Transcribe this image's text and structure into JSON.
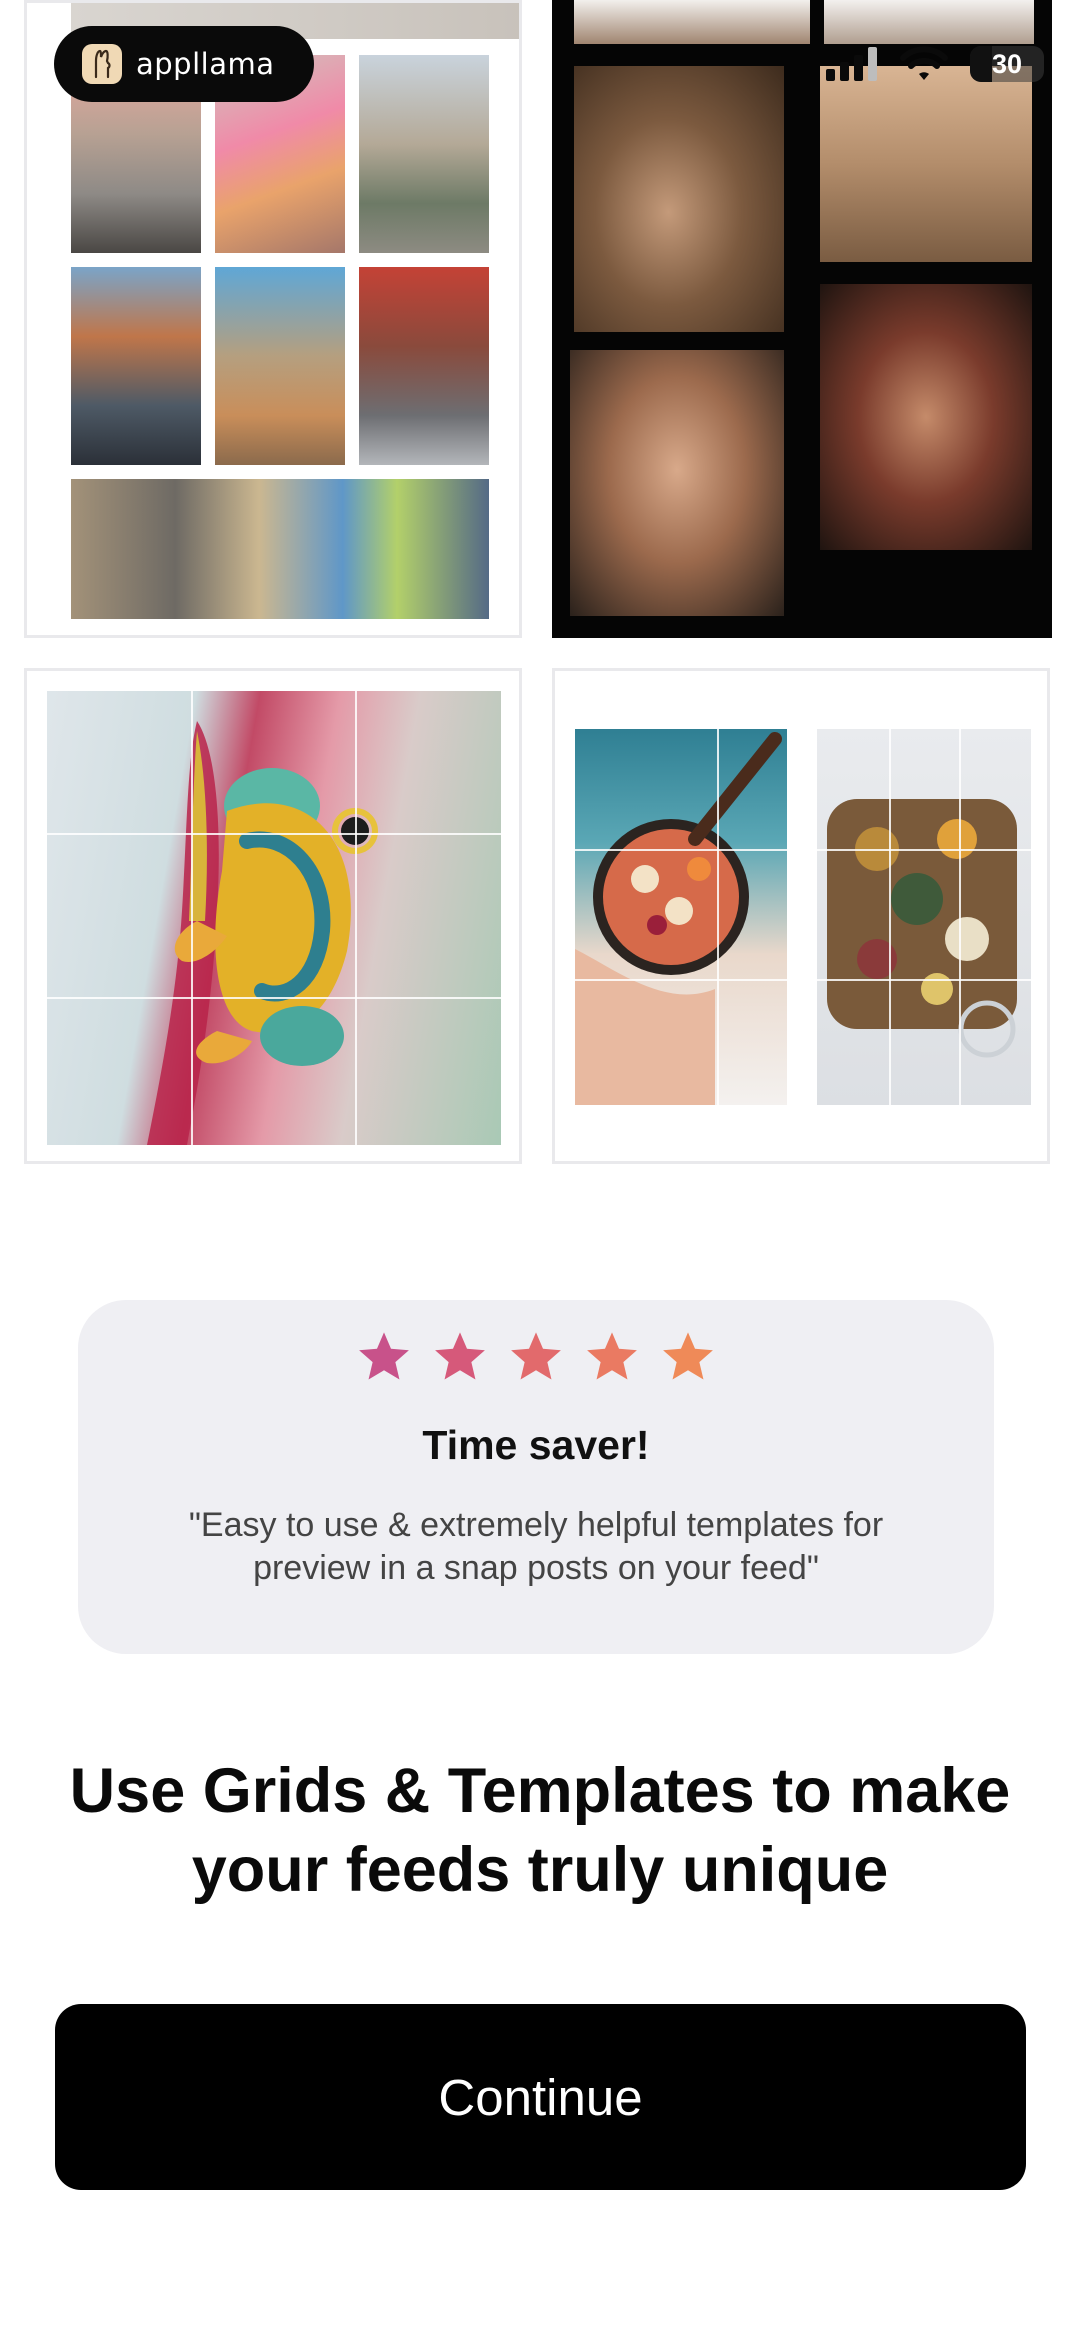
{
  "logo": {
    "text": "appllama",
    "icon": "llama-logo-icon"
  },
  "status_bar": {
    "battery_text": "30",
    "battery_level": 0.3,
    "icons": [
      "cellular-signal-icon",
      "wifi-icon",
      "battery-icon"
    ]
  },
  "templates": [
    {
      "name": "city-collage",
      "icon": "photo-collage"
    },
    {
      "name": "portrait-collage",
      "icon": "photo-collage"
    },
    {
      "name": "frog-grid",
      "icon": "grid-overlay"
    },
    {
      "name": "food-grid",
      "icon": "grid-overlay"
    }
  ],
  "review": {
    "stars": 5,
    "star_colors": [
      "#c8528a",
      "#d6597a",
      "#e26a6c",
      "#ea7a62",
      "#ef8a58"
    ],
    "title": "Time saver!",
    "quote": "\"Easy to use & extremely helpful templates for preview in a snap posts on your feed\""
  },
  "headline": "Use Grids & Templates to make your feeds truly unique",
  "continue_label": "Continue"
}
